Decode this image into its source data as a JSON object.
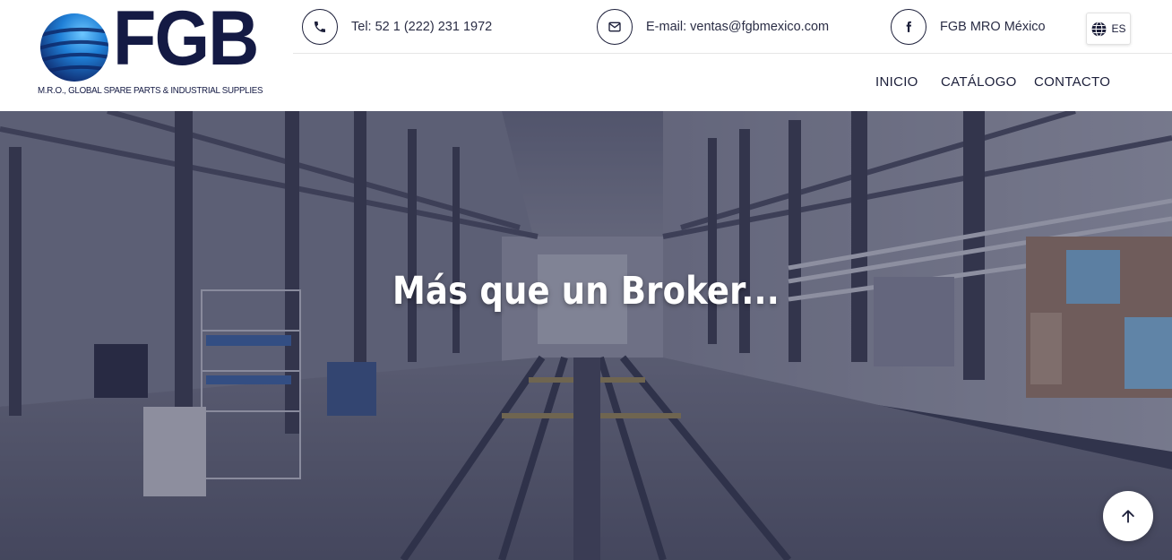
{
  "brand": {
    "logo_text": "FGB",
    "tagline": "M.R.O., GLOBAL SPARE PARTS & INDUSTRIAL SUPPLIES",
    "colors": {
      "navy": "#141a44",
      "globe_blue": "#1f7fd6"
    }
  },
  "topbar": {
    "phone": {
      "icon": "phone-icon",
      "label": "Tel: 52 1 (222) 231 1972"
    },
    "email": {
      "icon": "envelope-icon",
      "label": "E-mail: ventas@fgbmexico.com"
    },
    "facebook": {
      "icon": "facebook-icon",
      "label": "FGB MRO México"
    },
    "language": {
      "icon": "globe-icon",
      "code": "ES"
    }
  },
  "nav": {
    "items": [
      {
        "label": "INICIO"
      },
      {
        "label": "CATÁLOGO"
      },
      {
        "label": "CONTACTO"
      }
    ]
  },
  "hero": {
    "title": "Más que un Broker...",
    "background": "warehouse-photo"
  },
  "scroll_top": {
    "icon": "arrow-up-icon"
  }
}
